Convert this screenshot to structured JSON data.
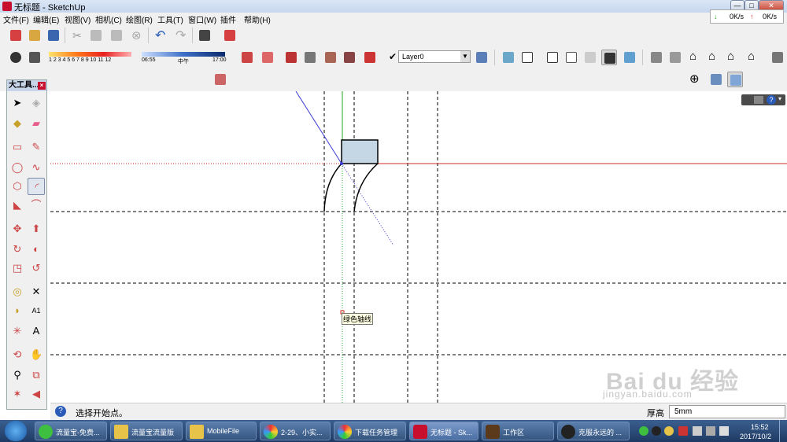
{
  "window": {
    "title": "无标题 - SketchUp",
    "minimize": "—",
    "maximize": "□",
    "close": "✕"
  },
  "menu": [
    "文件(F)",
    "编辑(E)",
    "视图(V)",
    "相机(C)",
    "绘图(R)",
    "工具(T)",
    "窗口(W)",
    "插件",
    "帮助(H)"
  ],
  "netspeed": {
    "down": "0K/s",
    "up": "0K/s"
  },
  "shadow": {
    "months": "1 2 3 4 5 6 7 8 9 10 11 12",
    "time_start": "06:55",
    "time_mid": "中午",
    "time_end": "17:00"
  },
  "layer": {
    "name": "Layer0"
  },
  "bigtools": {
    "title": "大工具..."
  },
  "canvas": {
    "tooltip": "绿色轴线"
  },
  "status": {
    "hint": "选择开始点。",
    "label": "厚高",
    "value": "5mm"
  },
  "taskbar": {
    "items": [
      "流量宝-免费...",
      "流量宝流量版",
      "MobileFile",
      "2-29、小实...",
      "下载任务管理",
      "无标题 - Sk...",
      "工作区",
      "克服永远的 ..."
    ],
    "time": "15:52",
    "date": "2017/10/2"
  },
  "watermark": {
    "brand": "Bai du 经验",
    "url": "jingyan.baidu.com"
  },
  "colors": {
    "red_axis": "#d62b2b",
    "green_axis": "#1faa1f",
    "blue_axis": "#3a3ad6",
    "rect_fill": "#c5d6e4"
  }
}
